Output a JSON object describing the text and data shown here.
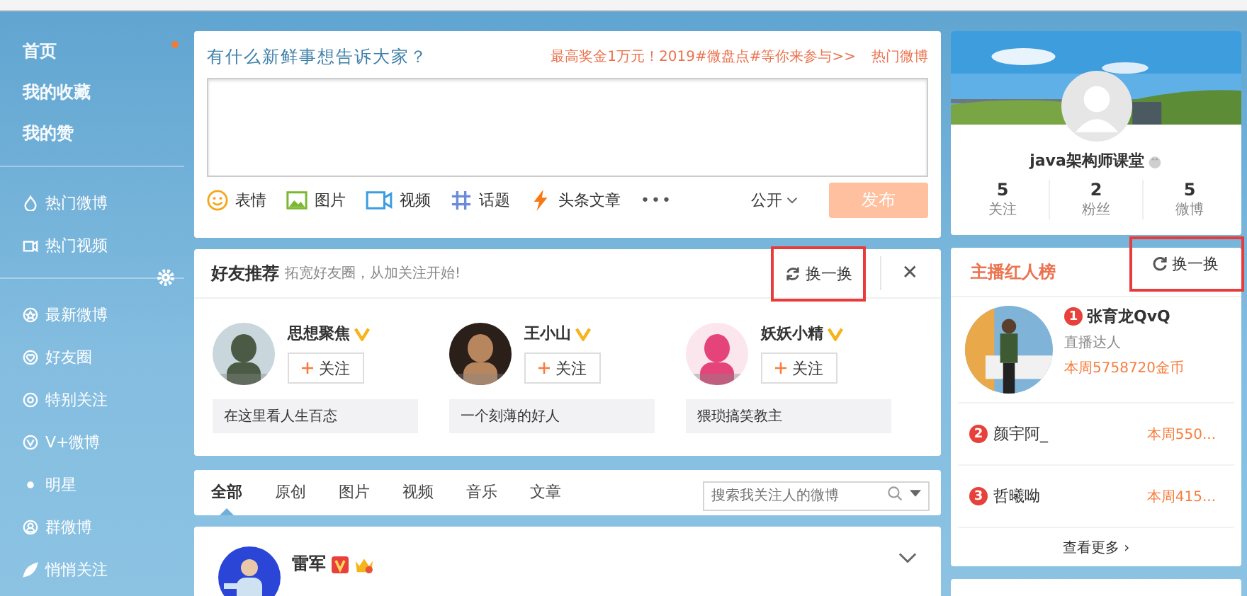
{
  "sidebar": {
    "top_items": [
      {
        "label": "首页",
        "selected": true
      },
      {
        "label": "我的收藏",
        "selected": false
      },
      {
        "label": "我的赞",
        "selected": false
      }
    ],
    "hot_items": [
      {
        "label": "热门微博"
      },
      {
        "label": "热门视频"
      }
    ],
    "group_items": [
      {
        "label": "最新微博"
      },
      {
        "label": "好友圈"
      },
      {
        "label": "特别关注"
      },
      {
        "label": "V+微博"
      },
      {
        "label": "明星"
      },
      {
        "label": "群微博"
      },
      {
        "label": "悄悄关注"
      }
    ]
  },
  "composer": {
    "prompt": "有什么新鲜事想告诉大家？",
    "promo": "最高奖金1万元！2019#微盘点#等你来参与>>",
    "hot_link": "热门微博",
    "tools": [
      {
        "label": "表情"
      },
      {
        "label": "图片"
      },
      {
        "label": "视频"
      },
      {
        "label": "话题"
      },
      {
        "label": "头条文章"
      }
    ],
    "more": "•••",
    "visibility": "公开",
    "post_button": "发布",
    "post_disabled": true
  },
  "friends": {
    "title": "好友推荐",
    "subtitle": "拓宽好友圈，从加关注开始!",
    "refresh": "换一换",
    "refresh_highlighted": true,
    "close": "✕",
    "people": [
      {
        "name": "思想聚焦",
        "verified": true,
        "follow": "关注",
        "bio": "在这里看人生百态"
      },
      {
        "name": "王小山",
        "verified": true,
        "follow": "关注",
        "bio": "一个刻薄的好人"
      },
      {
        "name": "妖妖小精",
        "verified": true,
        "follow": "关注",
        "bio": "猥琐搞笑教主"
      }
    ]
  },
  "feed_tabs": [
    {
      "label": "全部",
      "selected": true
    },
    {
      "label": "原创",
      "selected": false
    },
    {
      "label": "图片",
      "selected": false
    },
    {
      "label": "视频",
      "selected": false
    },
    {
      "label": "音乐",
      "selected": false
    },
    {
      "label": "文章",
      "selected": false
    }
  ],
  "feed_search": {
    "placeholder": "搜索我关注人的微博"
  },
  "post": {
    "author": "雷军"
  },
  "profile": {
    "name": "java架构师课堂",
    "stats": [
      {
        "value": "5",
        "label": "关注"
      },
      {
        "value": "2",
        "label": "粉丝"
      },
      {
        "value": "5",
        "label": "微博"
      }
    ]
  },
  "hot_list": {
    "title": "主播红人榜",
    "refresh": "换一换",
    "refresh_highlighted": true,
    "top": {
      "rank": "1",
      "name": "张育龙QvQ",
      "role": "直播达人",
      "coins": "本周5758720金币"
    },
    "rows": [
      {
        "rank": "2",
        "name": "颜宇阿_",
        "coins": "本周550..."
      },
      {
        "rank": "3",
        "name": "哲曦呦",
        "coins": "本周415..."
      }
    ],
    "more": "查看更多 ›"
  }
}
